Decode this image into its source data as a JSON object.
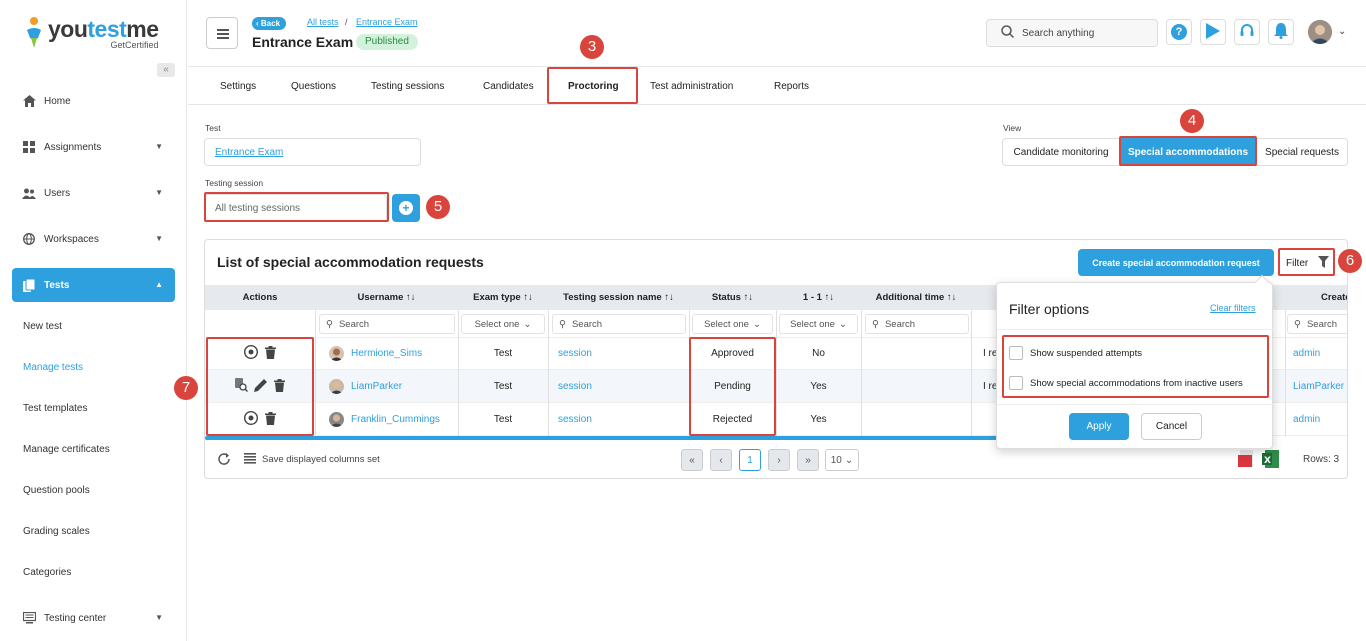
{
  "logo": {
    "word_a": "you",
    "word_b": "test",
    "word_c": "me",
    "sub": "GetCertified"
  },
  "sidebar": {
    "items": [
      {
        "label": "Home",
        "icon": "home-icon"
      },
      {
        "label": "Assignments",
        "icon": "assignments-icon"
      },
      {
        "label": "Users",
        "icon": "users-icon"
      },
      {
        "label": "Workspaces",
        "icon": "globe-icon"
      },
      {
        "label": "Tests",
        "icon": "tests-icon"
      },
      {
        "label": "Testing center",
        "icon": "testing-center-icon"
      }
    ],
    "sub_items": [
      "New test",
      "Manage tests",
      "Test templates",
      "Manage certificates",
      "Question pools",
      "Grading scales",
      "Categories"
    ]
  },
  "header": {
    "back": "Back",
    "crumb1": "All tests",
    "crumb_sep": "/",
    "crumb2": "Entrance Exam",
    "title": "Entrance Exam",
    "status": "Published",
    "search_placeholder": "Search anything"
  },
  "tabs": [
    "Settings",
    "Questions",
    "Testing sessions",
    "Candidates",
    "Proctoring",
    "Test administration",
    "Reports"
  ],
  "form": {
    "test_label": "Test",
    "test_value": "Entrance Exam",
    "session_label": "Testing session",
    "session_value": "All testing sessions",
    "view_label": "View",
    "views": [
      "Candidate monitoring",
      "Special accommodations",
      "Special requests"
    ]
  },
  "annotations": [
    "3",
    "4",
    "5",
    "6",
    "7"
  ],
  "table": {
    "title": "List of special accommodation requests",
    "create_label": "Create special accommodation request",
    "filter_label": "Filter",
    "columns": [
      "Actions",
      "Username ↑↓",
      "Exam type ↑↓",
      "Testing session name ↑↓",
      "Status ↑↓",
      "1 - 1 ↑↓",
      "Additional time ↑↓",
      "Create"
    ],
    "search_placeholder": "Search",
    "select_placeholder": "Select one",
    "rows": [
      {
        "username": "Hermione_Sims",
        "exam_type": "Test",
        "session": "session",
        "status": "Approved",
        "one_to_one": "No",
        "extra": "I re",
        "created_by": "admin"
      },
      {
        "username": "LiamParker",
        "exam_type": "Test",
        "session": "session",
        "status": "Pending",
        "one_to_one": "Yes",
        "extra": "I re",
        "created_by": "LiamParker"
      },
      {
        "username": "Franklin_Cummings",
        "exam_type": "Test",
        "session": "session",
        "status": "Rejected",
        "one_to_one": "Yes",
        "extra": "",
        "created_by": "admin"
      }
    ],
    "footer": {
      "save_columns": "Save displayed columns set",
      "page": "1",
      "page_size": "10",
      "rows_count": "Rows: 3"
    }
  },
  "filter_popup": {
    "title": "Filter options",
    "clear": "Clear filters",
    "options": [
      "Show suspended attempts",
      "Show special accommodations from inactive users"
    ],
    "apply": "Apply",
    "cancel": "Cancel"
  },
  "colors": {
    "accent": "#2ea0dd",
    "annotation": "#d9453c",
    "published_bg": "#d3f2db"
  }
}
